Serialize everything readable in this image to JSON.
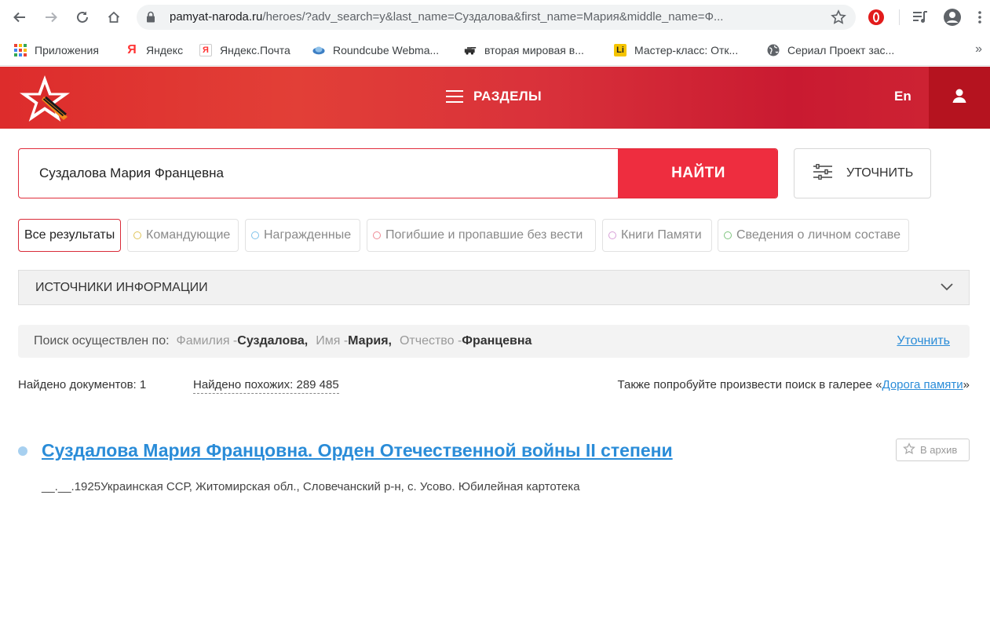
{
  "browser": {
    "url_host": "pamyat-naroda.ru",
    "url_path": "/heroes/?adv_search=y&last_name=Суздалова&first_name=Мария&middle_name=Ф...",
    "bookmarks": [
      {
        "label": "Приложения",
        "icon": "apps-grid-icon"
      },
      {
        "label": "Яндекс",
        "icon": "yandex-icon"
      },
      {
        "label": "Яндекс.Почта",
        "icon": "yandex-mail-icon"
      },
      {
        "label": "Roundcube Webma...",
        "icon": "roundcube-icon"
      },
      {
        "label": "вторая мировая в...",
        "icon": "ww2-icon"
      },
      {
        "label": "Мастер-класс: Отк...",
        "icon": "liveinternet-icon"
      },
      {
        "label": "Сериал Проект зас...",
        "icon": "globe-icon"
      }
    ],
    "bookmarks_more": "»"
  },
  "header": {
    "menu_label": "РАЗДЕЛЫ",
    "lang_label": "En",
    "colors": {
      "primary": "#dd2c2c",
      "dark": "#b5131f"
    }
  },
  "search": {
    "value": "Суздалова Мария Францевна",
    "button_label": "НАЙТИ",
    "refine_label": "УТОЧНИТЬ"
  },
  "tabs": [
    {
      "label": "Все результаты",
      "dot": null
    },
    {
      "label": "Командующие",
      "dot": "#e0c55a"
    },
    {
      "label": "Награжденные",
      "dot": "#7fc3ea"
    },
    {
      "label": "Погибшие и пропавшие без вести",
      "dot": "#ef8a95"
    },
    {
      "label": "Книги Памяти",
      "dot": "#d8a0d8"
    },
    {
      "label": "Сведения о личном составе",
      "dot": "#7fc47f"
    }
  ],
  "sources": {
    "label": "ИСТОЧНИКИ ИНФОРМАЦИИ"
  },
  "summary": {
    "lead": "Поиск осуществлен по:",
    "last_name_label": "Фамилия - ",
    "last_name_value": "Суздалова,",
    "first_name_label": "Имя - ",
    "first_name_value": "Мария,",
    "middle_name_label": "Отчество - ",
    "middle_name_value": "Францевна",
    "refine_link": "Уточнить"
  },
  "counts": {
    "found_docs": "Найдено документов: 1",
    "found_similar": "Найдено похожих: 289 485",
    "gallery_prefix": "Также попробуйте произвести поиск в галерее «",
    "gallery_link": "Дорога памяти",
    "gallery_suffix": "»"
  },
  "result": {
    "title": "Суздалова Мария Францовна. Орден Отечественной войны II степени",
    "archive_label": "В архив",
    "description": "__.__.1925Украинская ССР, Житомирская обл., Словечанский р-н, с. Усово. Юбилейная картотека"
  }
}
